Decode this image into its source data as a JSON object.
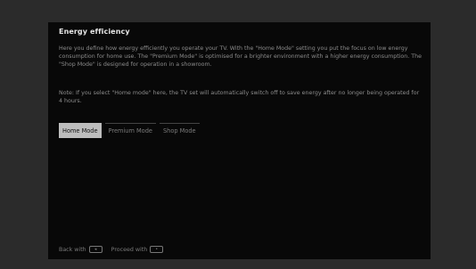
{
  "screen": {
    "title": "Energy efficiency",
    "paragraph_1": "Here you define how energy efficiently you operate your TV. With the \"Home Mode\" setting you put the focus on low energy consumption for home use. The \"Premium Mode\" is optimised for a brighter environment with a higher energy consumption. The \"Shop Mode\" is designed for operation in a showroom.",
    "paragraph_2": "Note: If you select \"Home mode\" here, the TV set will automatically switch off to save energy after no longer being operated for 4 hours.",
    "modes": [
      {
        "label": "Home Mode",
        "selected": true
      },
      {
        "label": "Premium Mode",
        "selected": false
      },
      {
        "label": "Shop Mode",
        "selected": false
      }
    ],
    "footer": {
      "back_label": "Back with",
      "back_key_icon": "back-key-icon",
      "proceed_label": "Proceed with",
      "proceed_key_icon": "ok-key-icon"
    }
  },
  "colors": {
    "background": "#2b2b2b",
    "screen": "#080808",
    "selected_mode": "#bdbdbd"
  }
}
